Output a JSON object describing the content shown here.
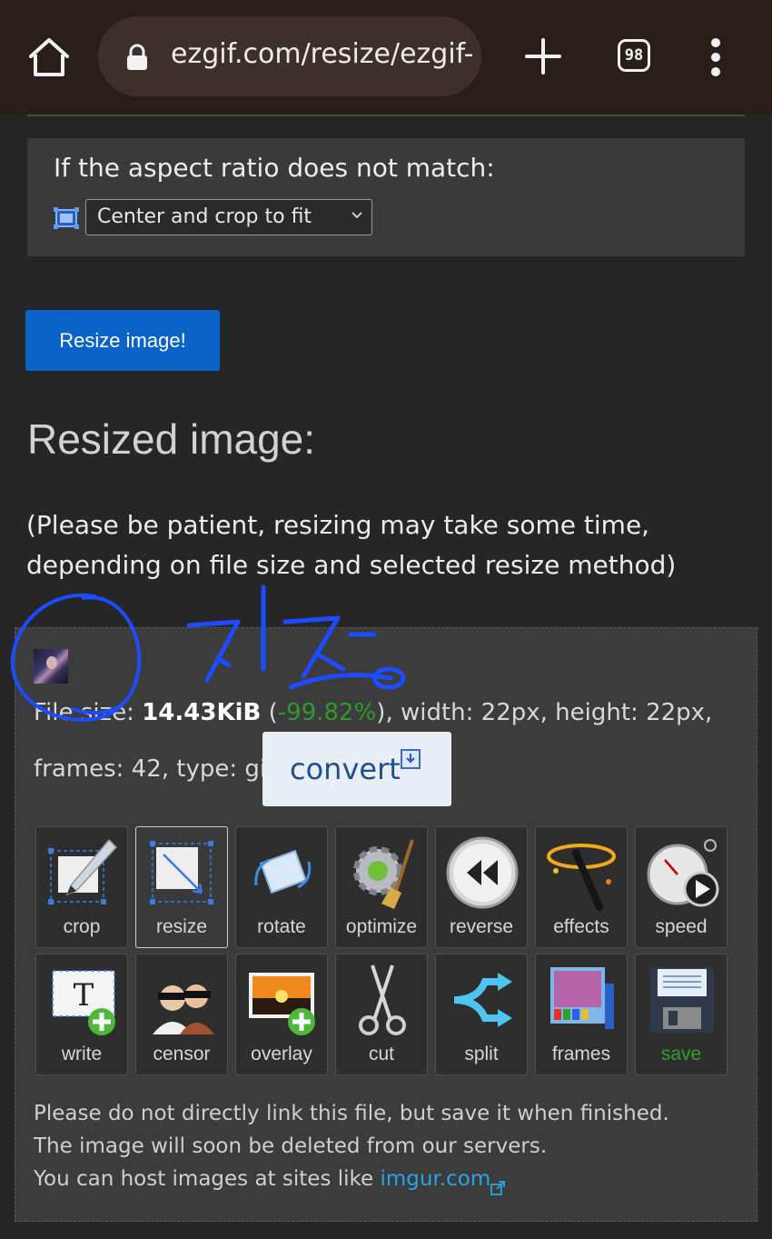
{
  "browser": {
    "url": "ezgif.com/resize/ezgif-",
    "tab_count": "98"
  },
  "aspect": {
    "label": "If the aspect ratio does not match:",
    "selected_option": "Center and crop to fit"
  },
  "resize_button": "Resize image!",
  "result": {
    "heading": "Resized image:",
    "patience_note": "(Please be patient, resizing may take some time, depending on file size and selected resize method)",
    "file_size_label": "File size: ",
    "file_size": "14.43KiB",
    "paren_open": " (",
    "size_change": "-99.82%",
    "dims": "), width: 22px, height: 22px,",
    "frames_type": "frames: 42, type: gif",
    "convert_label": "convert"
  },
  "tools": [
    {
      "label": "crop"
    },
    {
      "label": "resize"
    },
    {
      "label": "rotate"
    },
    {
      "label": "optimize"
    },
    {
      "label": "reverse"
    },
    {
      "label": "effects"
    },
    {
      "label": "speed"
    },
    {
      "label": "write"
    },
    {
      "label": "censor"
    },
    {
      "label": "overlay"
    },
    {
      "label": "cut"
    },
    {
      "label": "split"
    },
    {
      "label": "frames"
    },
    {
      "label": "save"
    }
  ],
  "notice": {
    "line1": "Please do not directly link this file, but save it when finished.",
    "line2": "The image will soon be deleted from our servers.",
    "line3": "You can host images at sites like ",
    "link": "imgur.com"
  },
  "colors": {
    "accent_blue": "#0a64c8",
    "percent_green": "#2e9a2e",
    "link_blue": "#2aa3e6",
    "annotation_blue": "#1d4cff"
  }
}
